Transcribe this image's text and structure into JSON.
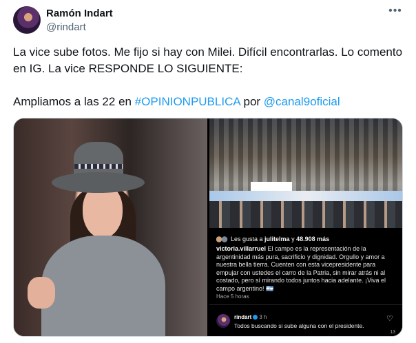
{
  "author": {
    "display_name": "Ramón Indart",
    "handle": "@rindart",
    "more_icon": "•••"
  },
  "tweet": {
    "line1": "La vice sube fotos. Me fijo si hay con Milei. Difícil encontrarlas. Lo comento en IG. La vice RESPONDE LO SIGUIENTE:",
    "line2_prefix": "Ampliamos a las 22 en ",
    "hashtag": "#OPINIONPUBLICA",
    "line2_mid": " por ",
    "mention": "@canal9oficial"
  },
  "instagram": {
    "likes_prefix": "Les gusta a ",
    "likes_user": "julitelma",
    "likes_mid": " y ",
    "likes_count": "48.908 más",
    "caption_user": "victoria.villarruel",
    "caption_text": " El campo es la representación de la argentinidad más pura, sacrificio y dignidad. Orgullo y amor a nuestra bella tierra. Cuenten con esta vicepresidente para empujar con ustedes el carro de la Patria, sin mirar atrás ni al costado, pero sí mirando todos juntos hacia adelante. ¡Viva el campo argentino! 🇦🇷",
    "time_ago": "Hace 5 horas",
    "comment_user": "rindart",
    "comment_time": "3 h",
    "comment_text": "Todos buscando si sube alguna con el presidente.",
    "heart_count": "13"
  },
  "colors": {
    "link": "#1d9bf0",
    "text": "#0f1419",
    "secondary": "#536471",
    "border": "#cfd9de"
  },
  "icons": [
    "more-icon",
    "heart-icon",
    "verified-badge-icon"
  ]
}
